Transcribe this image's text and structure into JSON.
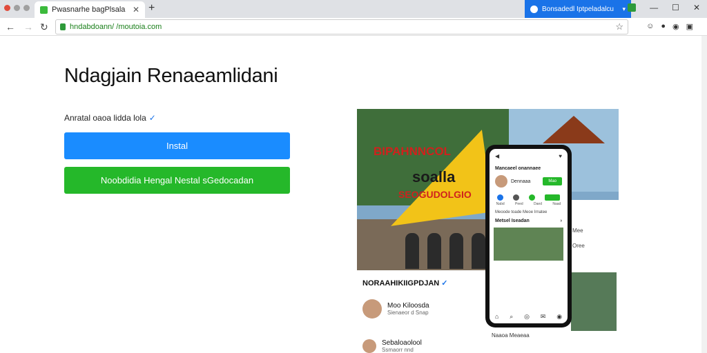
{
  "browser": {
    "tab_title": "Pwasnarhe bagPlsala",
    "tab_close": "✕",
    "new_tab": "+",
    "tab2_title": "Bonsadedl Iptpeladalcu",
    "tab2_menu": "▾",
    "url": "hndabdoann/ /moutoia.com",
    "win_controls": [
      "—",
      "☐",
      "✕"
    ]
  },
  "page": {
    "title": "Ndagjain Renaeamlidani",
    "subtitle": "Anratal oaoa lidda lola",
    "install_label": "Instal",
    "secondary_label": "Noobdidia Hengal Nestal sGedocadan"
  },
  "hero": {
    "flag_line1": "BIPAHNNCOL",
    "flag_line2": "soalla",
    "flag_line3": "SEOGUDOLGIO"
  },
  "card_below": {
    "title": "NORAAHIKIIGPDJAN",
    "rows": [
      {
        "name": "Moo Kiloosda",
        "sub": "Sienaeor d Snap"
      },
      {
        "name": "Sebaloaolool",
        "sub": "Ssmaorr nnd"
      }
    ]
  },
  "phone": {
    "header": "Mancaeel onannaee",
    "profile_name": "Dennaaa",
    "profile_btn": "Mao",
    "captions": [
      "Nabd",
      "Peed",
      "Daed",
      "Naad"
    ],
    "line": "Meoode toade Meoe Irnatee",
    "section": "Metsel Iseadan",
    "section_arrow": "›",
    "footer": "Naaoa Meaeaa"
  },
  "side_panel": {
    "items": [
      "Mee",
      "Oree"
    ]
  }
}
